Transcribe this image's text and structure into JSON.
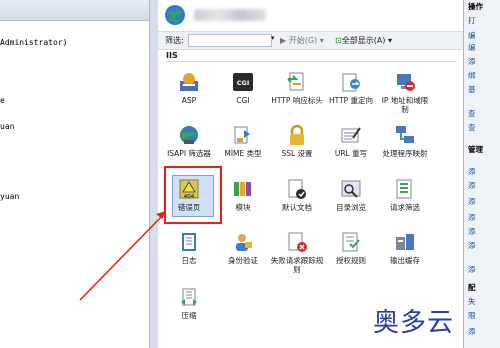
{
  "tree": {
    "nodes": [
      "Administrator)",
      "e",
      "uan",
      "yuan"
    ]
  },
  "center": {
    "filter_label": "筛选:",
    "start_label": "开始(G)",
    "show_all_label": "全部显示(A)",
    "section_title": "IIS"
  },
  "features": [
    {
      "icon": "asp-icon",
      "label": "ASP"
    },
    {
      "icon": "cgi-icon",
      "label": "CGI"
    },
    {
      "icon": "http-headers-icon",
      "label": "HTTP 响应标头"
    },
    {
      "icon": "http-redirect-icon",
      "label": "HTTP 重定向"
    },
    {
      "icon": "ip-domain-restrict-icon",
      "label": "IP 地址和域限制"
    },
    {
      "icon": "isapi-filter-icon",
      "label": "ISAPI 筛选器"
    },
    {
      "icon": "mime-type-icon",
      "label": "MIME 类型"
    },
    {
      "icon": "ssl-lock-icon",
      "label": "SSL 设置"
    },
    {
      "icon": "url-rewrite-icon",
      "label": "URL 重写"
    },
    {
      "icon": "handler-mappings-icon",
      "label": "处理程序映射"
    },
    {
      "icon": "error-pages-icon",
      "label": "错误页"
    },
    {
      "icon": "modules-icon",
      "label": "模块"
    },
    {
      "icon": "default-document-icon",
      "label": "默认文档"
    },
    {
      "icon": "directory-browse-icon",
      "label": "目录浏览"
    },
    {
      "icon": "request-filter-icon",
      "label": "请求筛选"
    },
    {
      "icon": "logging-icon",
      "label": "日志"
    },
    {
      "icon": "authentication-icon",
      "label": "身份验证"
    },
    {
      "icon": "failed-request-tracing-icon",
      "label": "失败请求跟踪规则"
    },
    {
      "icon": "authorization-rules-icon",
      "label": "授权规则"
    },
    {
      "icon": "output-cache-icon",
      "label": "输出缓存"
    },
    {
      "icon": "compression-icon",
      "label": "压缩"
    }
  ],
  "error_badge": "404",
  "actions": {
    "items": [
      "操作",
      "打",
      "编",
      "编",
      "添",
      "绑",
      "基",
      "查",
      "查",
      "管理",
      "添",
      "添",
      "添",
      "添",
      "添",
      "添",
      "添",
      "添",
      "添",
      "添",
      "添",
      "配",
      "失",
      "限",
      "添"
    ]
  },
  "watermark": "奥多云",
  "colors": {
    "highlight_border": "#e2221b",
    "arrow": "#e2221b"
  }
}
